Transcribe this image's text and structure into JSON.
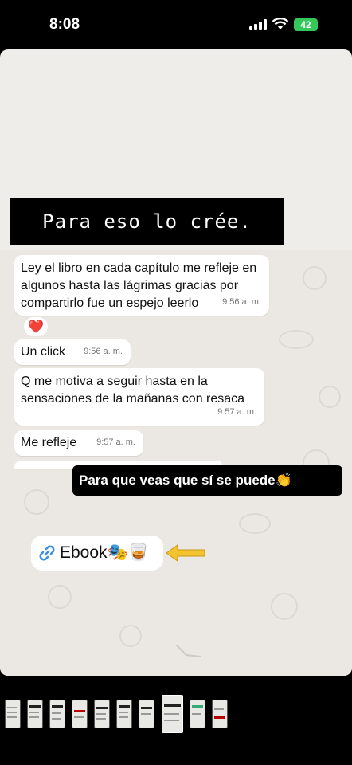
{
  "status_bar": {
    "time": "8:08",
    "battery": "42"
  },
  "story": {
    "title": "Para eso lo crée.",
    "caption": "Para que veas que sí se puede👏",
    "link_label": "Ebook🎭🥃"
  },
  "messages": [
    {
      "text": "Ley el libro en cada capítulo me refleje en algunos hasta las lágrimas gracias por compartirlo fue un espejo leerlo",
      "time": "9:56 a. m."
    },
    {
      "text": "Un click",
      "time": "9:56 a. m."
    },
    {
      "text": "Q me motiva a seguir hasta en la sensaciones de la mañanas con resaca",
      "time": "9:57 a. m."
    },
    {
      "text": "Me refleje",
      "time": "9:57 a. m."
    }
  ],
  "reaction": "❤️",
  "colors": {
    "battery": "#34c759",
    "arrow": "#f4c430",
    "title_bg": "#000000"
  },
  "icons": [
    "signal-icon",
    "wifi-icon",
    "battery-icon",
    "link-icon",
    "arrow-left-icon",
    "heart-icon"
  ]
}
